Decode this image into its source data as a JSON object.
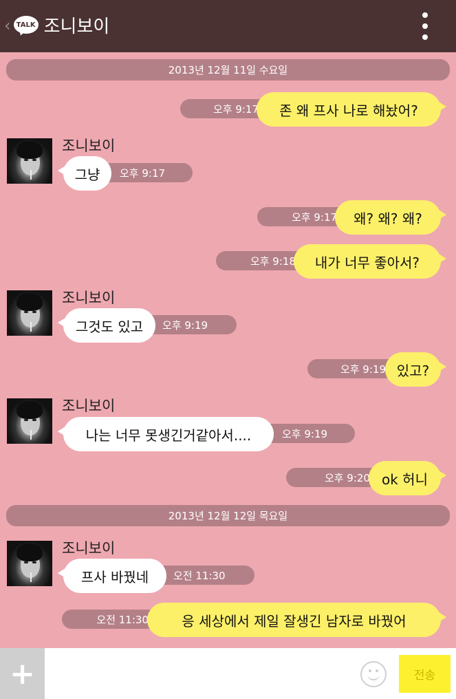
{
  "header": {
    "back_icon": "‹",
    "logo_text": "TALK",
    "title": "조니보이"
  },
  "messages": [
    {
      "type": "date",
      "text": "2013년 12월 11일 수요일"
    },
    {
      "type": "out",
      "text": "존 왜 프사 나로 해놨어?",
      "time": "오후 9:17"
    },
    {
      "type": "in",
      "sender": "조니보이",
      "text": "그냥",
      "time": "오후 9:17"
    },
    {
      "type": "out",
      "text": "왜? 왜? 왜?",
      "time": "오후 9:17"
    },
    {
      "type": "out",
      "text": "내가 너무 좋아서?",
      "time": "오후 9:18"
    },
    {
      "type": "in",
      "sender": "조니보이",
      "text": "그것도 있고",
      "time": "오후 9:19"
    },
    {
      "type": "out",
      "text": "있고?",
      "time": "오후 9:19"
    },
    {
      "type": "in",
      "sender": "조니보이",
      "text": "나는 너무 못생긴거같아서....",
      "time": "오후 9:19"
    },
    {
      "type": "out",
      "text": "ok 허니",
      "time": "오후 9:20"
    },
    {
      "type": "date",
      "text": "2013년 12월 12일 목요일"
    },
    {
      "type": "in",
      "sender": "조니보이",
      "text": "프사 바꿨네",
      "time": "오전 11:30"
    },
    {
      "type": "out",
      "text": "응 세상에서 제일 잘생긴 남자로 바꿨어",
      "time": "오전 11:30"
    }
  ],
  "composer": {
    "placeholder": "",
    "send_label": "전송"
  },
  "colors": {
    "background": "#eea8b0",
    "header": "#4a3233",
    "outgoing_bubble": "#fdf069",
    "incoming_bubble": "#ffffff",
    "timestamp_pill": "#b48088",
    "send_button": "#fdf02e"
  }
}
